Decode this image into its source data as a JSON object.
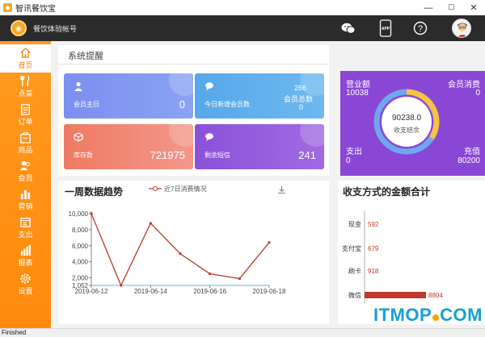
{
  "window": {
    "title": "智讯餐饮宝",
    "min": "—",
    "max": "☐",
    "close": "✕"
  },
  "header": {
    "account": "餐饮体验帐号",
    "icons": [
      "wechat-icon",
      "app-icon",
      "help-icon"
    ],
    "avatar": "avatar"
  },
  "sidebar": {
    "items": [
      {
        "label": "首页",
        "icon": "home-icon"
      },
      {
        "label": "点菜",
        "icon": "cutlery-icon"
      },
      {
        "label": "订单",
        "icon": "clipboard-icon"
      },
      {
        "label": "商品",
        "icon": "bag-icon"
      },
      {
        "label": "会员",
        "icon": "members-icon"
      },
      {
        "label": "营销",
        "icon": "bar-chart-icon"
      },
      {
        "label": "支出",
        "icon": "wallet-icon"
      },
      {
        "label": "报表",
        "icon": "report-icon"
      },
      {
        "label": "设置",
        "icon": "gear-icon"
      }
    ],
    "active_index": 0
  },
  "reminders": {
    "title": "系统提醒",
    "cards": [
      {
        "label": "会员主日",
        "value": "0",
        "icon": "user-icon",
        "color_from": "#7b8ff0",
        "color_to": "#8aa3f3"
      },
      {
        "label": "今日新增会员数",
        "value_top": "266",
        "value_mid": "会员总数",
        "value": "0",
        "icon": "chat-icon",
        "color_from": "#56a8ea",
        "color_to": "#6fb8ef"
      },
      {
        "label": "库存数",
        "value": "721975",
        "icon": "box-icon",
        "color_from": "#ef7a63",
        "color_to": "#f3978a"
      },
      {
        "label": "剩余短信",
        "value": "241",
        "icon": "message-icon",
        "color_from": "#8a52d9",
        "color_to": "#a16ae3"
      }
    ]
  },
  "finance": {
    "revenue_label": "营业额",
    "revenue": "10038",
    "member_spend_label": "会员消费",
    "member_spend": "0",
    "center_value": "90238.0",
    "center_label": "收支结余",
    "expense_label": "支出",
    "expense": "0",
    "recharge_label": "充值",
    "recharge": "80200",
    "colors": {
      "bg": "#8a47d6",
      "ring_a": "#f6c343",
      "ring_b": "#6ea7ee"
    }
  },
  "trend": {
    "title": "一周数据趋势",
    "download_icon": "download-icon",
    "chart_data": {
      "type": "line",
      "title": "",
      "series": [
        {
          "name": "近7日消费情况",
          "color": "#c0392b",
          "points": [
            {
              "x": "2019-06-12",
              "y": 10000
            },
            {
              "x": "2019-06-13",
              "y": 1052
            },
            {
              "x": "2019-06-14",
              "y": 8800
            },
            {
              "x": "2019-06-15",
              "y": 5000
            },
            {
              "x": "2019-06-16",
              "y": 2500
            },
            {
              "x": "2019-06-17",
              "y": 1900
            },
            {
              "x": "2019-06-18",
              "y": 6400
            }
          ]
        }
      ],
      "x_ticks": [
        "2019-06-12",
        "2019-06-14",
        "2019-06-16",
        "2019-06-18"
      ],
      "y_ticks": [
        "10,000",
        "8,000",
        "6,000",
        "4,000",
        "2,000",
        "1,052"
      ],
      "ylim": [
        1052,
        10000
      ]
    }
  },
  "payments": {
    "title": "收支方式的金额合计",
    "chart_data": {
      "type": "bar",
      "orientation": "horizontal",
      "categories": [
        "现金",
        "支付宝",
        "刷卡",
        "微信"
      ],
      "values": [
        592,
        679,
        918,
        8804
      ],
      "value_labels": [
        "592",
        "679",
        "918",
        "8804"
      ],
      "bar_color": "#c0392b"
    }
  },
  "status": {
    "text": "Finished"
  },
  "watermark": {
    "text_a": "ITMOP",
    "text_b": "COM"
  }
}
